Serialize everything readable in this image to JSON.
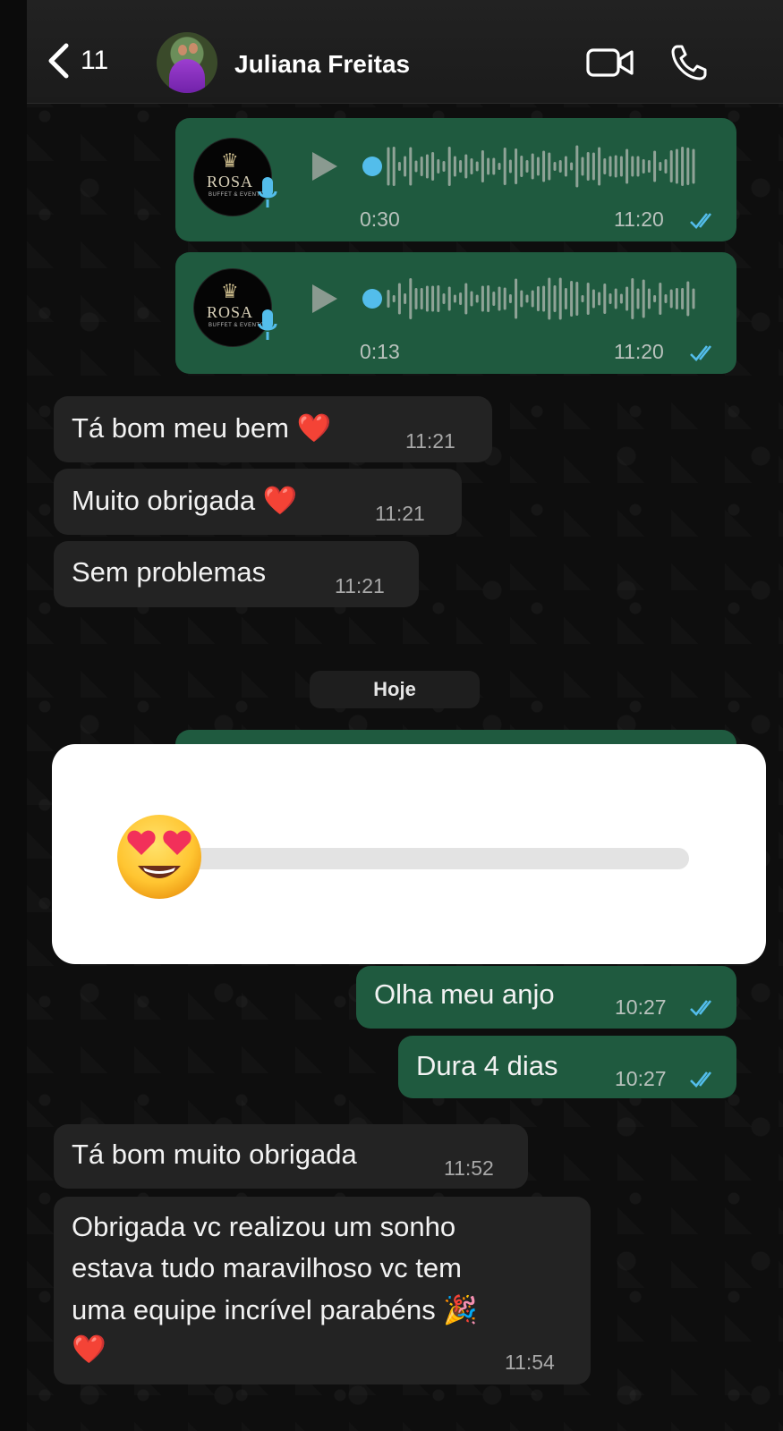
{
  "header": {
    "back_count": "11",
    "contact_name": "Juliana Freitas"
  },
  "voice_notes": [
    {
      "duration": "0:30",
      "time": "11:20",
      "avatar_text": "ROSA",
      "avatar_sub": "BUFFET & EVENTOS"
    },
    {
      "duration": "0:13",
      "time": "11:20",
      "avatar_text": "ROSA",
      "avatar_sub": "BUFFET & EVENTOS"
    }
  ],
  "incoming_1": [
    {
      "text": "Tá bom meu bem ❤️",
      "time": "11:21"
    },
    {
      "text": "Muito obrigada ❤️",
      "time": "11:21"
    },
    {
      "text": "Sem problemas",
      "time": "11:21"
    }
  ],
  "day_separator": "Hoje",
  "slider": {
    "emoji": "heart-eyes-face",
    "value": 0.03,
    "fill_color": "#e9487b"
  },
  "outgoing": [
    {
      "text": "Olha meu anjo",
      "time": "10:27"
    },
    {
      "text": "Dura 4 dias",
      "time": "10:27"
    }
  ],
  "incoming_2": [
    {
      "text": "Tá bom muito obrigada",
      "time": "11:52"
    },
    {
      "lines": [
        "Obrigada vc realizou um sonho",
        "estava tudo maravilhoso vc tem",
        "uma equipe incrível parabéns 🎉",
        "❤️"
      ],
      "time": "11:54"
    }
  ],
  "colors": {
    "outgoing_bubble": "#1f5a3f",
    "incoming_bubble": "#232323",
    "read_ticks": "#53bdeb"
  }
}
